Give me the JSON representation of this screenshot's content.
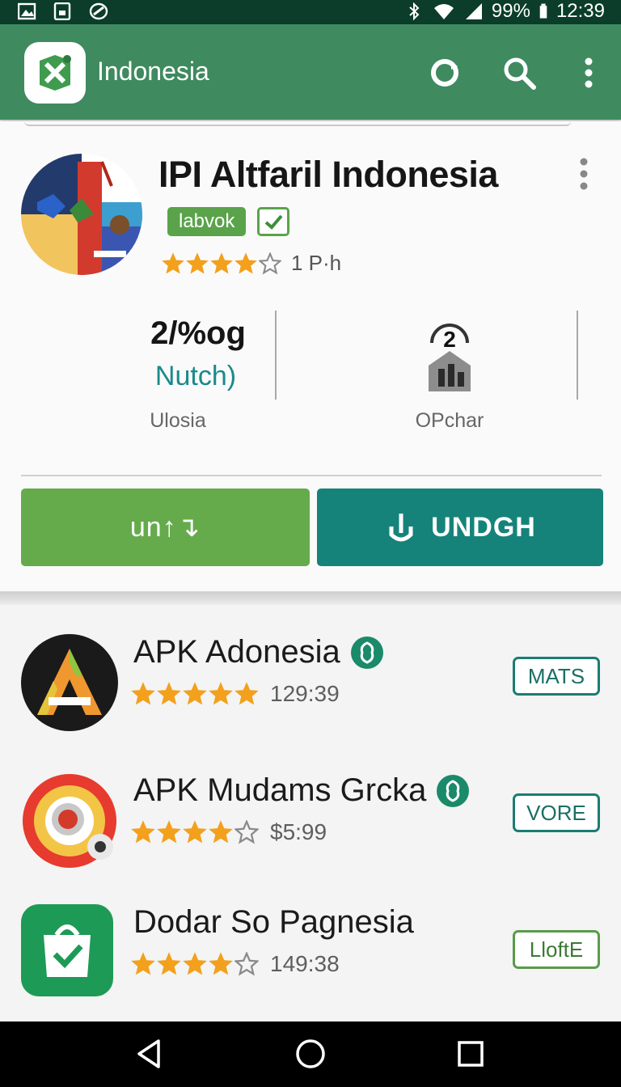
{
  "status_bar": {
    "battery": "99%",
    "time": "12:39",
    "icons": [
      "photo-icon",
      "gallery-icon",
      "sync-icon",
      "bluetooth-icon",
      "wifi-icon",
      "signal-icon",
      "battery-icon"
    ]
  },
  "app_bar": {
    "title": "Indonesia",
    "actions": [
      "refresh-icon",
      "search-icon",
      "more-vert-icon"
    ]
  },
  "hero": {
    "title": "IPI Altfaril Indonesia",
    "badge": "labvok",
    "rating": 4,
    "rating_max": 5,
    "rating_meta": "1 P·h",
    "stat_left": {
      "value": "2/%og",
      "accent": "Nutch)",
      "label": "Ulosia"
    },
    "stat_right": {
      "icon_number": "2",
      "label": "OPchar"
    },
    "update_label": "un↑↴",
    "install_label": "UNDGH"
  },
  "colors": {
    "app_bar": "#3f8a5f",
    "status_bar": "#0b3d2a",
    "update_button": "#65ab4c",
    "install_button": "#16837a",
    "star": "#f3a01c",
    "badge": "#5aa34b"
  },
  "list": [
    {
      "title": "APK Adonesia",
      "rating": 5,
      "meta": "129:39",
      "action": "MATS"
    },
    {
      "title": "APK Mudams Grcka",
      "rating": 4,
      "meta": "$5:99",
      "action": "VORE"
    },
    {
      "title": "Dodar So Pagnesia",
      "rating": 4,
      "meta": "149:38",
      "action": "LloftE"
    }
  ]
}
